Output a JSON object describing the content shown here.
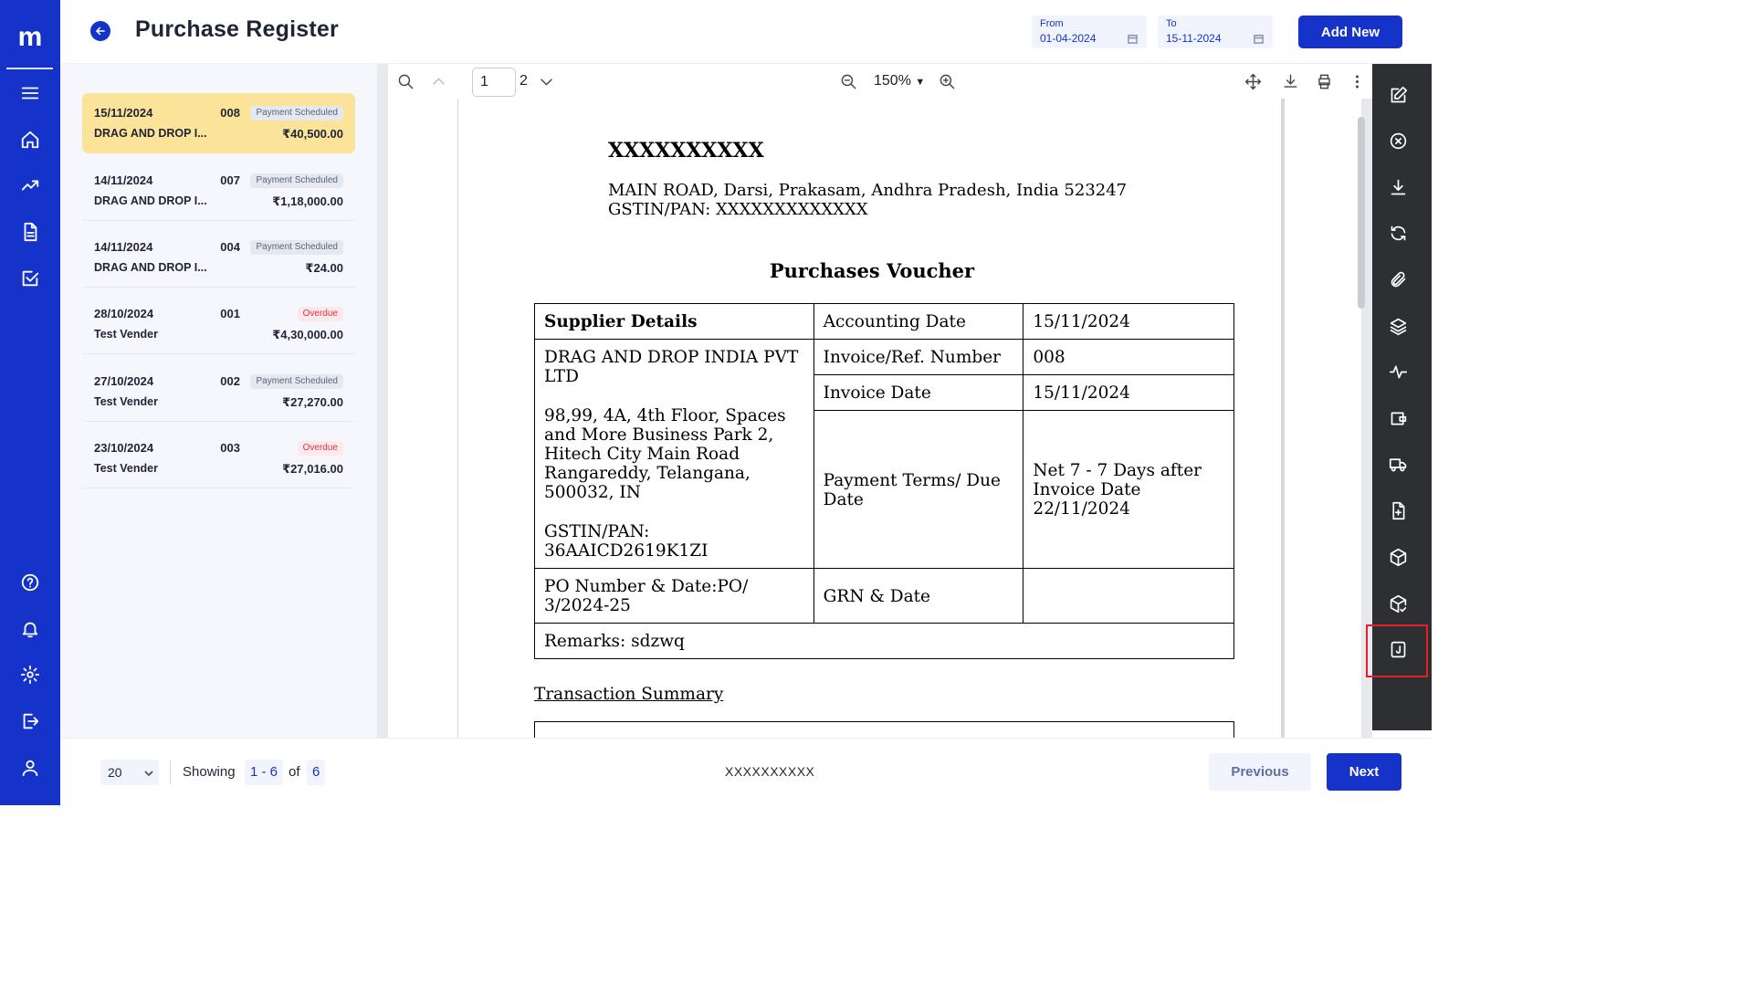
{
  "app": {
    "logo": "m"
  },
  "header": {
    "title": "Purchase Register",
    "from_label": "From",
    "from_value": "01-04-2024",
    "to_label": "To",
    "to_value": "15-11-2024",
    "add_new": "Add New"
  },
  "list": [
    {
      "date": "15/11/2024",
      "number": "008",
      "status": "Payment Scheduled",
      "name": "DRAG AND DROP I...",
      "amount": "₹40,500.00"
    },
    {
      "date": "14/11/2024",
      "number": "007",
      "status": "Payment Scheduled",
      "name": "DRAG AND DROP I...",
      "amount": "₹1,18,000.00"
    },
    {
      "date": "14/11/2024",
      "number": "004",
      "status": "Payment Scheduled",
      "name": "DRAG AND DROP I...",
      "amount": "₹24.00"
    },
    {
      "date": "28/10/2024",
      "number": "001",
      "status": "Overdue",
      "name": "Test Vender",
      "amount": "₹4,30,000.00"
    },
    {
      "date": "27/10/2024",
      "number": "002",
      "status": "Payment Scheduled",
      "name": "Test Vender",
      "amount": "₹27,270.00"
    },
    {
      "date": "23/10/2024",
      "number": "003",
      "status": "Overdue",
      "name": "Test Vender",
      "amount": "₹27,016.00"
    }
  ],
  "viewer": {
    "current_page": "1",
    "total_pages": "2",
    "zoom": "150%"
  },
  "document": {
    "company": "XXXXXXXXXX",
    "address_line1": "MAIN ROAD, Darsi, Prakasam, Andhra Pradesh, India 523247",
    "address_line2": "GSTIN/PAN: XXXXXXXXXXXXX",
    "heading": "Purchases Voucher",
    "supplier_details_label": "Supplier Details",
    "accounting_date_label": "Accounting Date",
    "accounting_date": "15/11/2024",
    "supplier_name": "DRAG AND DROP INDIA PVT LTD",
    "supplier_address": "98,99, 4A, 4th Floor, Spaces and More Business Park 2, Hitech City Main Road Rangareddy, Telangana, 500032, IN",
    "supplier_gstin_label": "GSTIN/PAN:",
    "supplier_gstin": "36AAICD2619K1ZI",
    "invoice_ref_label": "Invoice/Ref. Number",
    "invoice_ref": "008",
    "invoice_date_label": "Invoice Date",
    "invoice_date": "15/11/2024",
    "payment_terms_label": "Payment Terms/ Due Date",
    "payment_terms": "Net 7 - 7 Days after Invoice Date 22/11/2024",
    "po_label": "PO Number & Date:PO/ 3/2024-25",
    "grn_label": "GRN & Date",
    "grn_value": "",
    "remarks": "Remarks: sdzwq",
    "summary_heading": "Transaction Summary"
  },
  "footer": {
    "per_page": "20",
    "showing_label": "Showing",
    "range": "1 - 6",
    "of_label": "of",
    "total": "6",
    "company": "XXXXXXXXXX",
    "previous": "Previous",
    "next": "Next"
  },
  "colors": {
    "brand": "#1533c9",
    "active_row": "#fbe49a",
    "overdue": "#e0324a",
    "toolbar_dark": "#2d2f33",
    "highlight": "#e0202a"
  }
}
